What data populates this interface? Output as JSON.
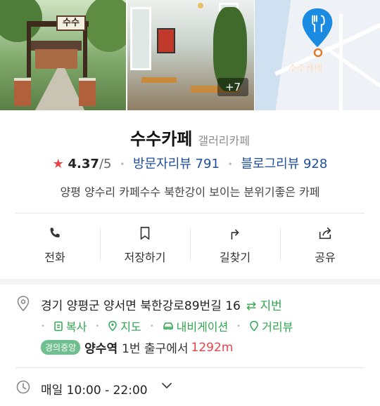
{
  "photos": {
    "gate_sign": "수수",
    "more_count": "+7",
    "map_label": "수수카페"
  },
  "place": {
    "name": "수수카페",
    "category": "갤러리카페",
    "rating": "4.37",
    "rating_max": "/5",
    "visitor_reviews": "방문자리뷰 791",
    "blog_reviews": "블로그리뷰 928",
    "description": "양평 양수리 카페수수 북한강이 보이는 분위기좋은 카페"
  },
  "actions": [
    {
      "label": "전화"
    },
    {
      "label": "저장하기"
    },
    {
      "label": "길찾기"
    },
    {
      "label": "공유"
    }
  ],
  "info": {
    "address": "경기 양평군 양서면 북한강로89번길 16",
    "jibun": "⇄ 지번",
    "links": [
      "복사",
      "지도",
      "내비게이션",
      "거리뷰"
    ],
    "line_badge": "경의중앙",
    "station": "양수역",
    "exit": "1번 출구에서",
    "distance": "1292m",
    "hours": "매일 10:00 - 22:00"
  },
  "colors": {
    "accent_green": "#2fa64e",
    "link_blue": "#1d4ea0",
    "star_red": "#e84349",
    "map_pin": "#1a8be0"
  }
}
